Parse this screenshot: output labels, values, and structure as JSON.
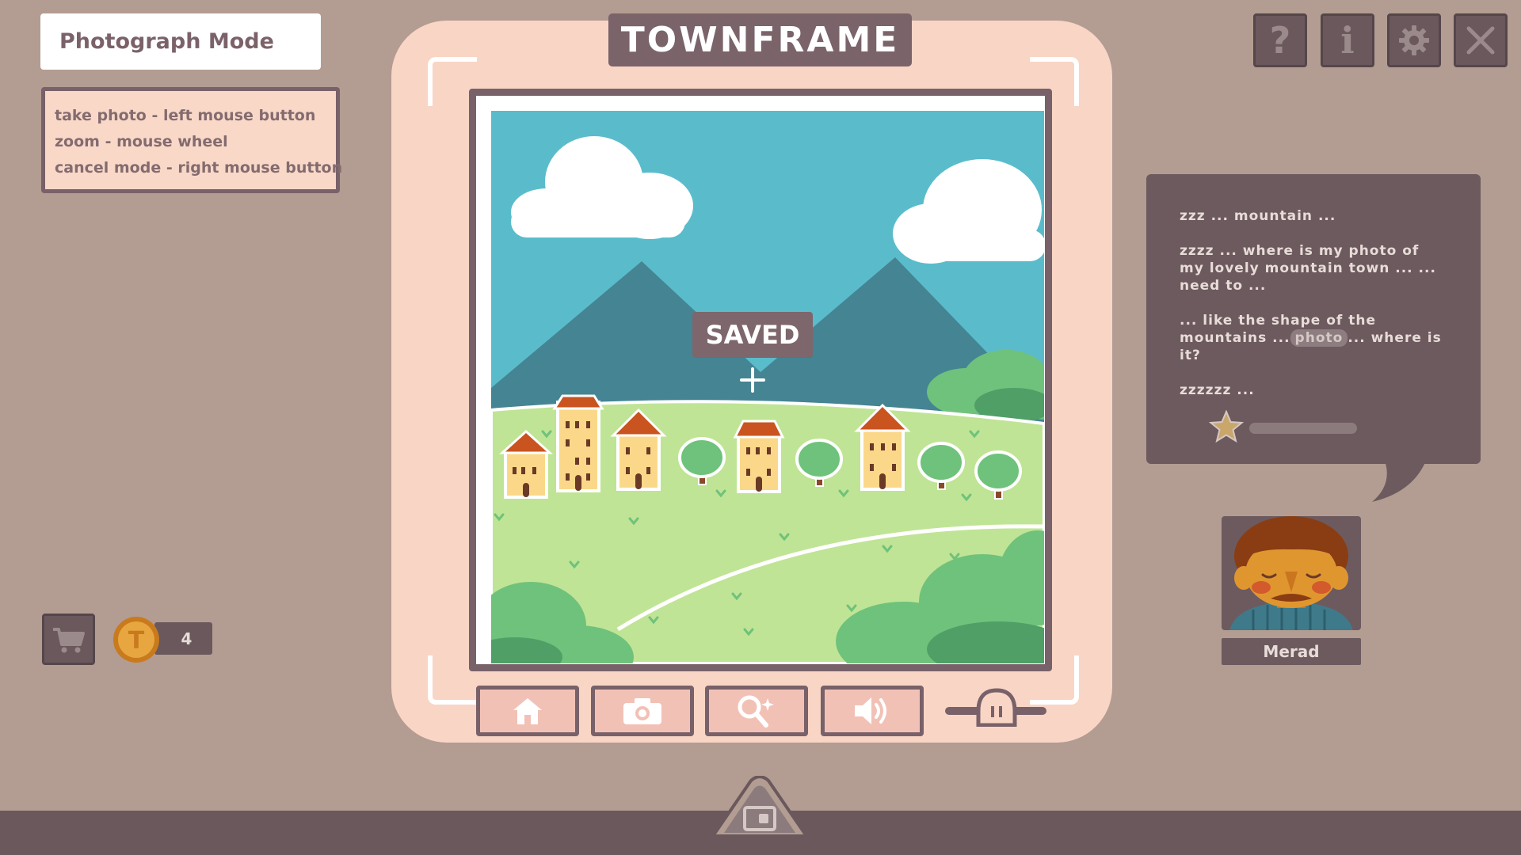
{
  "mode": {
    "title": "Photograph Mode"
  },
  "help": {
    "lines": [
      "take photo - left mouse button",
      "zoom - mouse wheel",
      "cancel mode - right mouse button"
    ]
  },
  "header": {
    "game_title": "TOWNFRAME"
  },
  "top_buttons": {
    "help_glyph": "?",
    "info_glyph": "i"
  },
  "photo": {
    "status": "SAVED"
  },
  "toolbar": {
    "buttons": [
      "home-icon",
      "camera-icon",
      "magnifier-sparkle-icon",
      "speaker-icon"
    ],
    "slider_icon": "pause-icon"
  },
  "wallet": {
    "coin_count": "4",
    "coin_letter": "T"
  },
  "dialogue": {
    "line1": "zzz ... mountain ...",
    "line2": "zzzz ... where is my photo of my lovely mountain town ... ... need to ...",
    "line3_a": "... like the shape of the mountains ...",
    "line3_chip": "photo",
    "line3_b": "... where is it?",
    "line4": "zzzzzz ..."
  },
  "character": {
    "name": "Merad"
  },
  "colors": {
    "background": "#b39c91",
    "frame": "#f9d5c5",
    "dark_panel": "#6d5a5f",
    "sky": "#5abccb",
    "mountain": "#458493",
    "grass": "#c0e495",
    "roof": "#c9541f"
  }
}
